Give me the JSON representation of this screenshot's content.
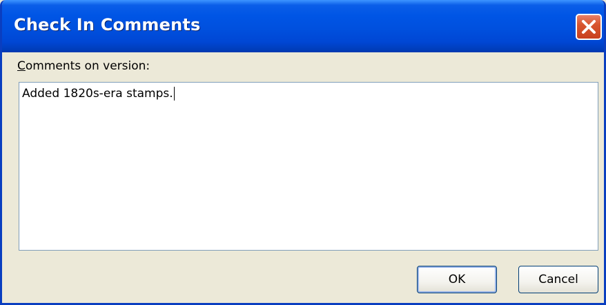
{
  "window": {
    "title": "Check In Comments",
    "close_icon": "close-icon",
    "title_bar_color": "#0055e5",
    "close_button_color": "#d8552e"
  },
  "form": {
    "label_mnemonic": "C",
    "label_rest": "omments on version:",
    "comments_value": "Added 1820s-era stamps."
  },
  "buttons": {
    "ok_label": "OK",
    "cancel_label": "Cancel"
  }
}
